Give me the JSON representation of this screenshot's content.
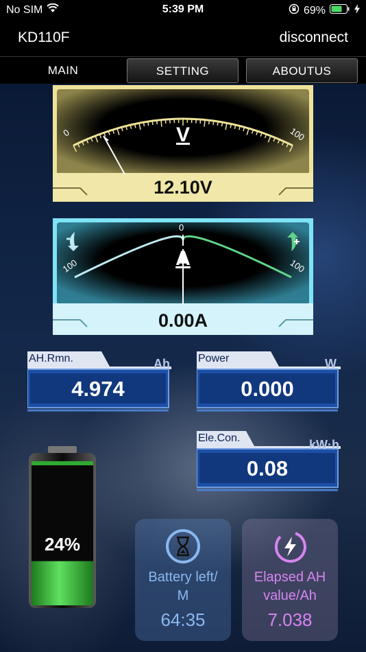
{
  "status_bar": {
    "carrier": "No SIM",
    "time": "5:39 PM",
    "battery_percent": "69%"
  },
  "header": {
    "device_name": "KD110F",
    "disconnect_label": "disconnect"
  },
  "tabs": [
    {
      "label": "MAIN"
    },
    {
      "label": "SETTING"
    },
    {
      "label": "ABOUTUS"
    }
  ],
  "voltage_meter": {
    "unit": "V",
    "scale_min": "0",
    "scale_max": "100",
    "reading": "12.10V"
  },
  "current_meter": {
    "unit": "A",
    "scale_left": "100",
    "scale_zero": "0",
    "scale_right": "100",
    "reading": "0.00A"
  },
  "panels": {
    "ah_remaining": {
      "label": "AH.Rmn.",
      "unit": "Ah",
      "value": "4.974"
    },
    "power": {
      "label": "Power",
      "unit": "W",
      "value": "0.000"
    },
    "energy": {
      "label": "Ele.Con.",
      "unit": "kW·h",
      "value": "0.08"
    }
  },
  "battery": {
    "percent_label": "24%",
    "level": 0.24
  },
  "cards": {
    "battery_left": {
      "label": "Battery left/\nM",
      "value": "64:35"
    },
    "elapsed_ah": {
      "label": "Elapsed AH\nvalue/Ah",
      "value": "7.038"
    }
  },
  "colors": {
    "voltage_accent": "#efe29a",
    "current_accent": "#7fe3f5",
    "panel_blue": "#1c4fa6",
    "elapsed_purple": "#d685f0",
    "timer_blue": "#8ab8f0"
  }
}
